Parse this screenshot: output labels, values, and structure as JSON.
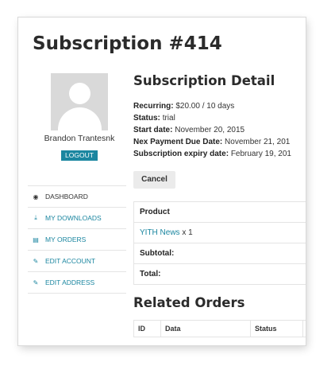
{
  "page": {
    "title": "Subscription #414"
  },
  "sidebar": {
    "user_name": "Brandon Trantesnk",
    "logout_label": "LOGOUT",
    "nav": [
      {
        "label": "DASHBOARD",
        "icon": "dashboard-icon",
        "glyph": "◉"
      },
      {
        "label": "MY DOWNLOADS",
        "icon": "download-icon",
        "glyph": "⤓"
      },
      {
        "label": "MY ORDERS",
        "icon": "file-icon",
        "glyph": "▤"
      },
      {
        "label": "EDIT ACCOUNT",
        "icon": "edit-icon",
        "glyph": "✎"
      },
      {
        "label": "EDIT ADDRESS",
        "icon": "edit-icon",
        "glyph": "✎"
      }
    ]
  },
  "detail": {
    "title": "Subscription Detail",
    "recurring_label": "Recurring:",
    "recurring_value": "$20.00 / 10 days",
    "status_label": "Status:",
    "status_value": "trial",
    "start_label": "Start date:",
    "start_value": "November 20, 2015",
    "next_label": "Nex Payment Due Date:",
    "next_value": "November 21, 201",
    "expiry_label": "Subscription expiry date:",
    "expiry_value": "February 19, 201",
    "cancel_label": "Cancel"
  },
  "product_table": {
    "header": "Product",
    "item_name": "YITH News",
    "item_qty": "x 1",
    "subtotal_label": "Subtotal:",
    "total_label": "Total:"
  },
  "related": {
    "title": "Related Orders",
    "columns": [
      "ID",
      "Data",
      "Status"
    ]
  },
  "colors": {
    "accent": "#1b86a0",
    "button_bg": "#ebebeb",
    "avatar_bg": "#d9d9d9"
  }
}
